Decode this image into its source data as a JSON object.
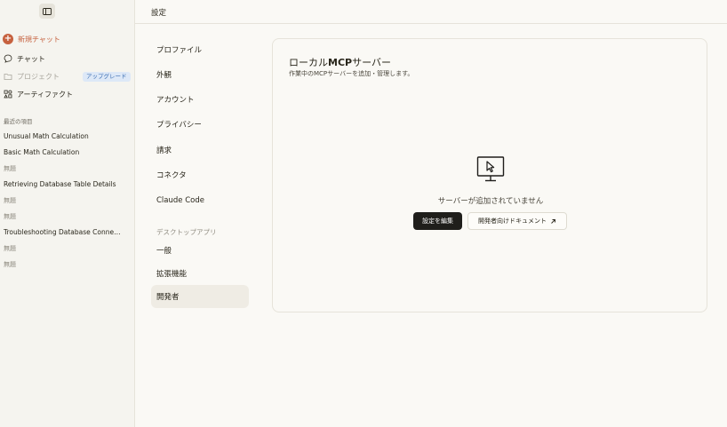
{
  "topbar": {
    "title": "設定"
  },
  "sidebar": {
    "new_chat": "新規チャット",
    "chat": "チャット",
    "projects": "プロジェクト",
    "upgrade": "アップグレード",
    "artifacts": "アーティファクト",
    "recent_heading": "最近の項目",
    "recent": [
      "Unusual Math Calculation",
      "Basic Math Calculation",
      "無題",
      "Retrieving Database Table Details",
      "無題",
      "無題",
      "Troubleshooting Database Connection",
      "無題",
      "無題"
    ]
  },
  "settings_nav": {
    "items": [
      "プロファイル",
      "外観",
      "アカウント",
      "プライバシー",
      "請求",
      "コネクタ",
      "Claude Code"
    ],
    "section_desktop": "デスクトップアプリ",
    "desktop_items": [
      "一般",
      "拡張機能",
      "開発者"
    ],
    "active": "開発者"
  },
  "card": {
    "title_prefix": "ローカル",
    "title_bold": "MCP",
    "title_suffix": "サーバー",
    "subtitle": "作業中のMCPサーバーを追加・管理します。",
    "empty_message": "サーバーが追加されていません",
    "edit_button": "設定を編集",
    "docs_button": "開発者向けドキュメント"
  },
  "colors": {
    "accent": "#c6613f",
    "badge_bg": "#dde8f7",
    "badge_text": "#3d6fb3"
  }
}
